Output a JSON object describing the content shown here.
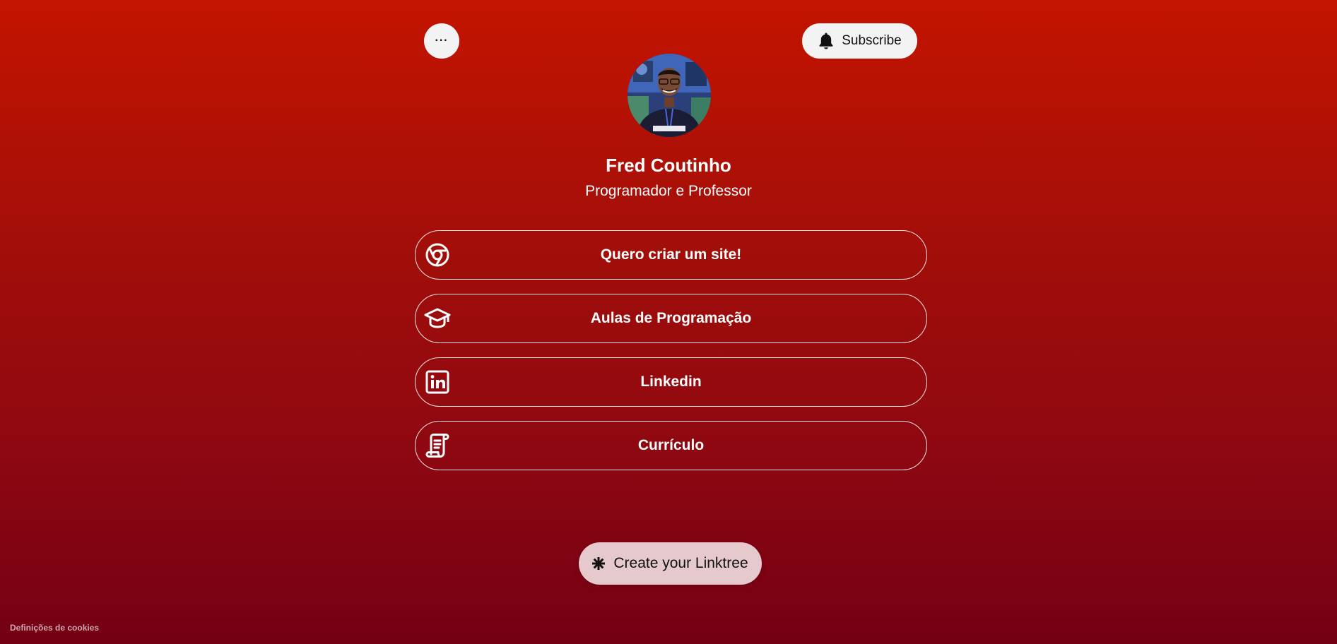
{
  "header": {
    "more_label": "···",
    "subscribe_label": "Subscribe"
  },
  "profile": {
    "name": "Fred Coutinho",
    "bio": "Programador e Professor"
  },
  "links": [
    {
      "label": "Quero criar um site!",
      "icon": "chrome-icon"
    },
    {
      "label": "Aulas de Programação",
      "icon": "graduation-cap-icon"
    },
    {
      "label": "Linkedin",
      "icon": "linkedin-icon"
    },
    {
      "label": "Currículo",
      "icon": "scroll-icon"
    }
  ],
  "footer": {
    "create_label": "Create your Linktree",
    "cookie_label": "Definições de cookies"
  },
  "colors": {
    "gradient_top": "#c31400",
    "gradient_bottom": "#740014",
    "button_light": "#f3f3f3",
    "create_button": "#e6c9cd"
  }
}
